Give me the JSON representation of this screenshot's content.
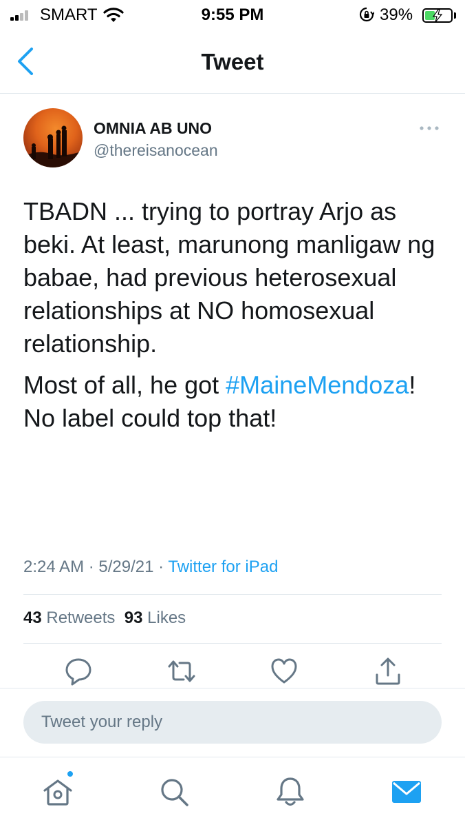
{
  "status_bar": {
    "carrier": "SMART",
    "time": "9:55 PM",
    "battery_percent": "39%",
    "battery_level": 0.39,
    "charging": true
  },
  "nav": {
    "title": "Tweet",
    "back_icon": "chevron-left-icon"
  },
  "tweet": {
    "display_name": "OMNIA AB UNO",
    "handle": "@thereisanocean",
    "paragraph1": "TBADN ... trying to portray Arjo as beki.   At least, marunong manligaw ng babae, had previous heterosexual relationships at NO homosexual relationship.",
    "paragraph2_before": "Most of all, he got ",
    "hashtag": "#MaineMendoza",
    "paragraph2_after": "!  No label could top that!",
    "timestamp": "2:24 AM · 5/29/21 · ",
    "source": "Twitter for iPad",
    "retweets_count": "43",
    "retweets_label": "Retweets",
    "likes_count": "93",
    "likes_label": "Likes"
  },
  "actions": [
    "reply-icon",
    "retweet-icon",
    "like-icon",
    "share-icon"
  ],
  "reply": {
    "placeholder": "Tweet your reply"
  },
  "tabbar": [
    "home-icon",
    "search-icon",
    "notifications-icon",
    "messages-icon"
  ],
  "colors": {
    "accent": "#1da1f2",
    "secondary_text": "#657786",
    "primary_text": "#14171a",
    "battery_green": "#4cd964"
  }
}
